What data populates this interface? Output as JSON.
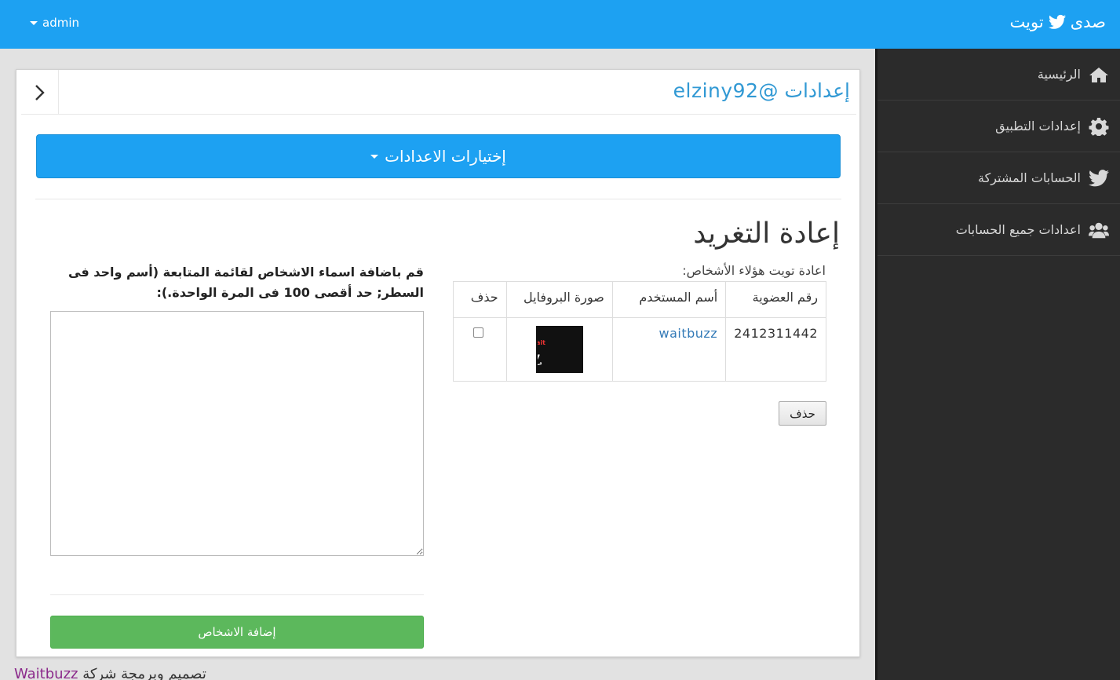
{
  "topbar": {
    "brand_text_left": "صدى",
    "brand_text_right": "تويت",
    "user": "admin",
    "bg_color": "#1da1f2"
  },
  "sidebar": {
    "items": [
      {
        "label": "الرئيسية",
        "icon": "home-icon"
      },
      {
        "label": "إعدادات التطبيق",
        "icon": "gear-icon"
      },
      {
        "label": "الحسابات المشتركة",
        "icon": "twitter-icon"
      },
      {
        "label": "اعدادات جميع الحسابات",
        "icon": "users-icon"
      }
    ]
  },
  "panel": {
    "title": "إعدادات @elziny92",
    "options_button": "إختيارات الاعدادات",
    "section_title": "إعادة التغريد",
    "section_subtitle": "اعادة تويت هؤلاء الأشخاص:",
    "table": {
      "headers": [
        "رقم العضوية",
        "أسم المستخدم",
        "صورة البروفايل",
        "حذف"
      ],
      "rows": [
        {
          "member_id": "2412311442",
          "username": "waitbuzz",
          "avatar_text": "Wait BuzZ",
          "checked": false
        }
      ]
    },
    "delete_button": "حذف",
    "add_label": "قم باضافة اسماء الاشخاص لقائمة المتابعة (أسم واحد فى السطر; حد أقصى 100 فى المرة الواحدة.):",
    "names_value": "",
    "add_button": "إضافة الاشخاص"
  },
  "footer": {
    "text": "تصميم وبرمجة شركة",
    "company": "Waitbuzz"
  }
}
